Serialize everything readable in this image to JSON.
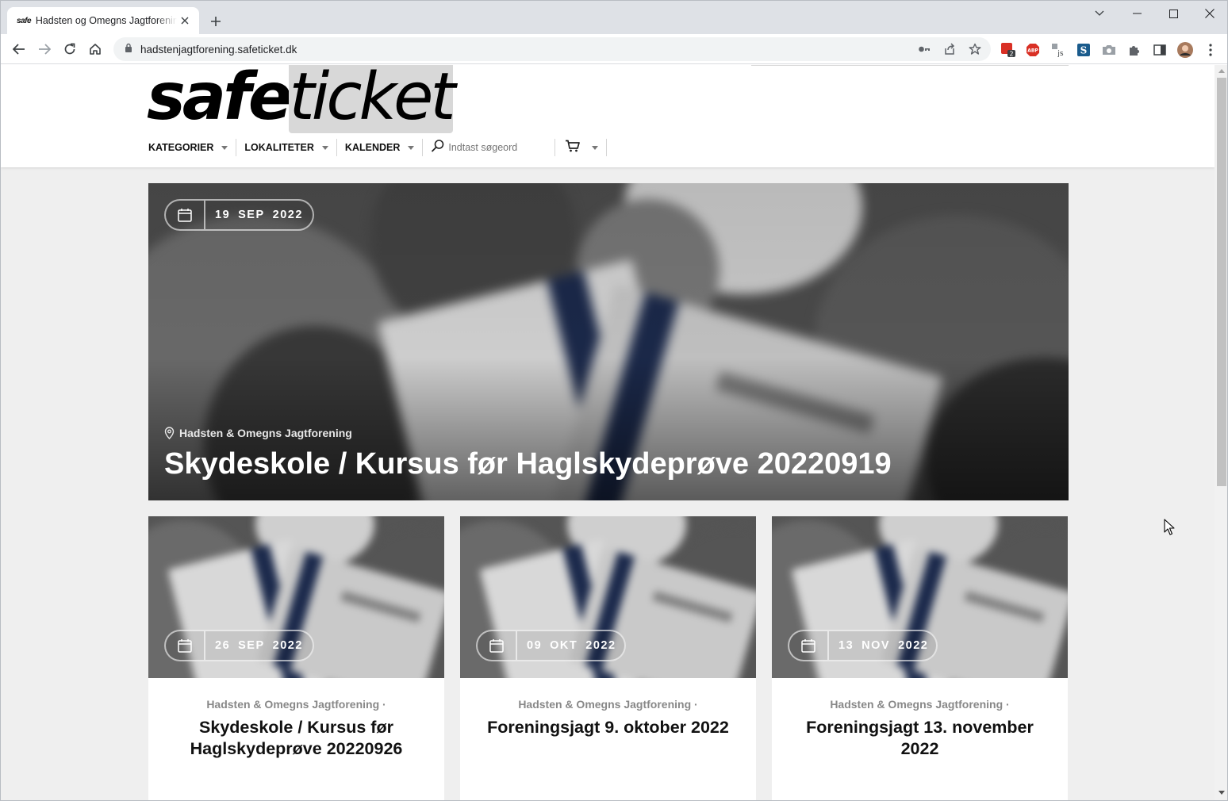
{
  "browser": {
    "tab_favicon_text": "safe",
    "tab_title": "Hadsten og Omegns Jagtforening",
    "url": "hadstenjagtforening.safeticket.dk"
  },
  "site": {
    "logo_safe": "safe",
    "logo_ticket": "ticket",
    "nav": {
      "categories": "KATEGORIER",
      "locations": "LOKALITETER",
      "calendar": "KALENDER"
    },
    "search_placeholder": "Indtast søgeord"
  },
  "hero": {
    "date_day": "19",
    "date_month": "SEP",
    "date_year": "2022",
    "location": "Hadsten & Omegns Jagtforening",
    "title": "Skydeskole / Kursus før Haglskydeprøve 20220919"
  },
  "cards": [
    {
      "date_day": "26",
      "date_month": "SEP",
      "date_year": "2022",
      "organizer": "Hadsten & Omegns Jagtforening ·",
      "title": "Skydeskole / Kursus før Haglskydeprøve 20220926"
    },
    {
      "date_day": "09",
      "date_month": "OKT",
      "date_year": "2022",
      "organizer": "Hadsten & Omegns Jagtforening ·",
      "title": "Foreningsjagt 9. oktober 2022"
    },
    {
      "date_day": "13",
      "date_month": "NOV",
      "date_year": "2022",
      "organizer": "Hadsten & Omegns Jagtforening ·",
      "title": "Foreningsjagt 13. november 2022"
    }
  ],
  "colors": {
    "page_bg": "#efefef",
    "ticket_stripe": "#1c2a4c",
    "chrome_bg": "#dee1e6"
  }
}
